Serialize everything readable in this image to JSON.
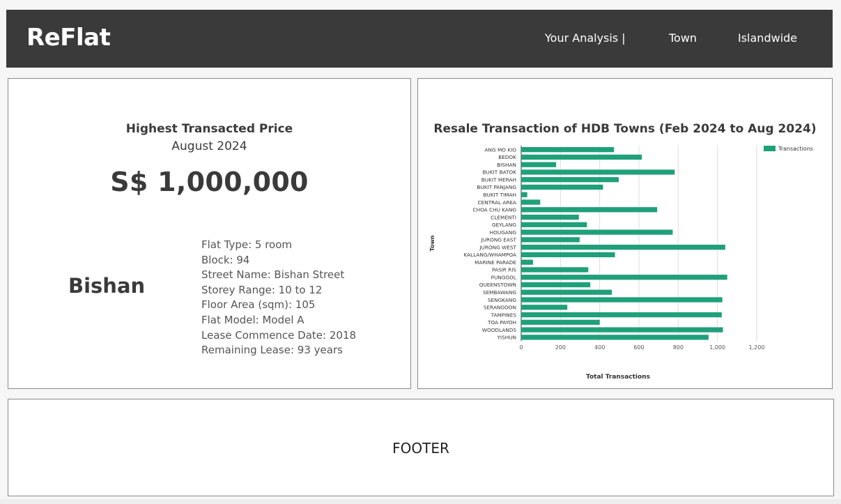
{
  "header": {
    "logo": "ReFlat",
    "nav": [
      {
        "label": "Your Analysis |"
      },
      {
        "label": "Town"
      },
      {
        "label": "Islandwide"
      }
    ]
  },
  "highest_price": {
    "title": "Highest Transacted Price",
    "date": "August 2024",
    "price": "S$ 1,000,000",
    "town": "Bishan",
    "details": [
      "Flat Type:  5 room",
      "Block: 94",
      "Street Name: Bishan Street",
      "Storey Range: 10 to 12",
      "Floor Area (sqm): 105",
      "Flat Model: Model A",
      "Lease Commence Date: 2018",
      "Remaining Lease: 93 years"
    ]
  },
  "chart_title": "Resale Transaction of HDB Towns (Feb 2024 to Aug 2024)",
  "chart_data": {
    "type": "bar",
    "orientation": "horizontal",
    "title": "Resale Transaction of HDB Towns (Feb 2024 to Aug 2024)",
    "xlabel": "Total Transactions",
    "ylabel": "Town",
    "xlim": [
      0,
      1200
    ],
    "xticks": [
      "0",
      "200",
      "400",
      "600",
      "800",
      "1,000",
      "1,200"
    ],
    "grid": true,
    "legend_position": "top-right",
    "series": [
      {
        "name": "Transactions",
        "color": "#1fa07a"
      }
    ],
    "categories": [
      "ANG MO KIO",
      "BEDOK",
      "BISHAN",
      "BUKIT BATOK",
      "BUKIT MERAH",
      "BUKIT PANJANG",
      "BUKIT TIMAH",
      "CENTRAL AREA",
      "CHOA CHU KANG",
      "CLEMENTI",
      "GEYLANG",
      "HOUGANG",
      "JURONG EAST",
      "JURONG WEST",
      "KALLANG/WHAMPOA",
      "MARINE PARADE",
      "PASIR RIS",
      "PUNGGOL",
      "QUEENSTOWN",
      "SEMBAWANG",
      "SENGKANG",
      "SERANGOON",
      "TAMPINES",
      "TOA PAYOH",
      "WOODLANDS",
      "YISHUN"
    ],
    "values": [
      473,
      615,
      178,
      782,
      497,
      417,
      31,
      97,
      693,
      294,
      335,
      772,
      298,
      1040,
      478,
      60,
      342,
      1050,
      352,
      462,
      1025,
      235,
      1022,
      400,
      1028,
      955
    ]
  },
  "footer": {
    "label": "FOOTER"
  }
}
